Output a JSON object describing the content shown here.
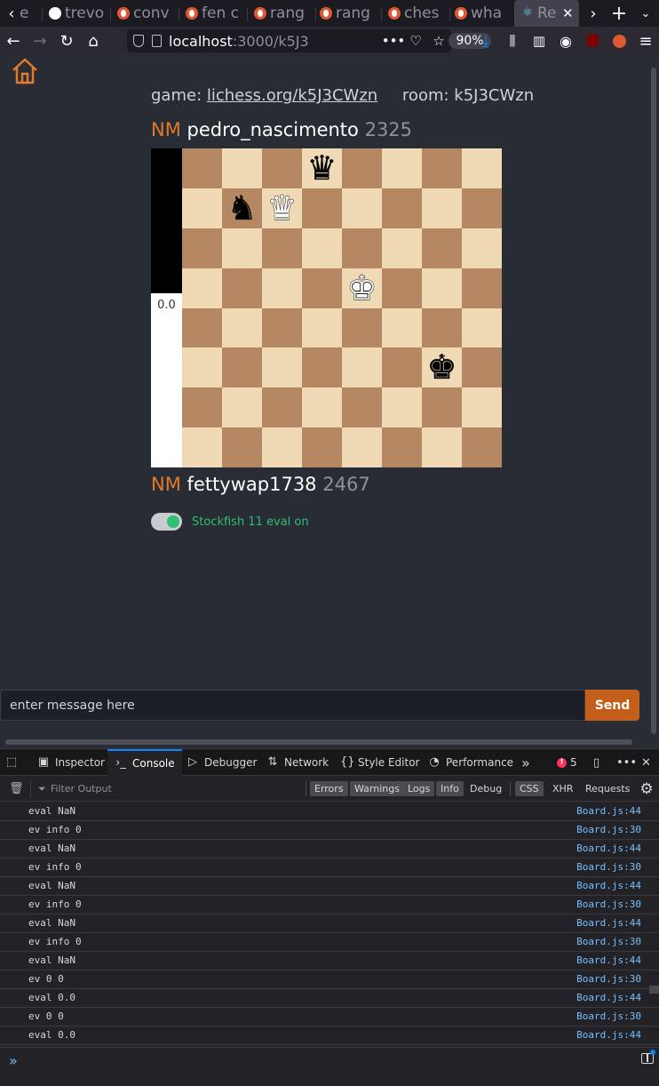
{
  "browser": {
    "tabs": [
      {
        "title": "e",
        "icon": "duckduckgo-icon"
      },
      {
        "title": "trevo",
        "icon": "github-icon"
      },
      {
        "title": "conv",
        "icon": "duckduckgo-icon"
      },
      {
        "title": "fen c",
        "icon": "duckduckgo-icon"
      },
      {
        "title": "rang",
        "icon": "duckduckgo-icon"
      },
      {
        "title": "rang",
        "icon": "duckduckgo-icon"
      },
      {
        "title": "ches",
        "icon": "duckduckgo-icon"
      },
      {
        "title": "wha",
        "icon": "duckduckgo-icon"
      },
      {
        "title": "Re",
        "icon": "react-icon",
        "active": true
      }
    ],
    "url_host": "localhost",
    "url_rest": ":3000/k5J3",
    "zoom": "90%"
  },
  "app": {
    "game_label": "game:",
    "game_link": "lichess.org/k5J3CWzn",
    "room_label": "room:",
    "room_id": "k5J3CWzn",
    "top_player": {
      "title": "NM",
      "name": "pedro_nascimento",
      "rating": "2325"
    },
    "bottom_player": {
      "title": "NM",
      "name": "fettywap1738",
      "rating": "2467"
    },
    "eval_value": "0.0",
    "eval_black_fraction": 0.455,
    "board": {
      "orientation": "black-bottom",
      "pieces": [
        {
          "square": "b6",
          "piece": "black-king"
        },
        {
          "square": "d4",
          "piece": "white-king"
        },
        {
          "square": "g2",
          "piece": "black-knight"
        },
        {
          "square": "f2",
          "piece": "white-queen"
        },
        {
          "square": "e1",
          "piece": "black-queen"
        }
      ]
    },
    "engine_toggle": {
      "on": true,
      "label": "Stockfish 11 eval on"
    },
    "chat": {
      "placeholder": "enter message here",
      "send_label": "Send"
    }
  },
  "devtools": {
    "tabs": [
      "Inspector",
      "Console",
      "Debugger",
      "Network",
      "Style Editor",
      "Performance"
    ],
    "active_tab": "Console",
    "error_count": "5",
    "filter_placeholder": "Filter Output",
    "filters": [
      "Errors",
      "Warnings",
      "Logs",
      "Info",
      "Debug"
    ],
    "extra_filters": [
      "CSS",
      "XHR",
      "Requests"
    ],
    "logs": [
      {
        "msg": "eval NaN",
        "src": "Board.js:44"
      },
      {
        "msg": "ev info 0",
        "src": "Board.js:30"
      },
      {
        "msg": "eval NaN",
        "src": "Board.js:44"
      },
      {
        "msg": "ev info 0",
        "src": "Board.js:30"
      },
      {
        "msg": "eval NaN",
        "src": "Board.js:44"
      },
      {
        "msg": "ev info 0",
        "src": "Board.js:30"
      },
      {
        "msg": "eval NaN",
        "src": "Board.js:44"
      },
      {
        "msg": "ev info 0",
        "src": "Board.js:30"
      },
      {
        "msg": "eval NaN",
        "src": "Board.js:44"
      },
      {
        "msg": "ev 0 0",
        "src": "Board.js:30"
      },
      {
        "msg": "eval 0.0",
        "src": "Board.js:44"
      },
      {
        "msg": "ev 0 0",
        "src": "Board.js:30"
      },
      {
        "msg": "eval 0.0",
        "src": "Board.js:44"
      }
    ]
  },
  "colors": {
    "accent_orange": "#e07b2c",
    "send_button": "#c35f1a",
    "toggle_green": "#2fbf71",
    "board_light": "#f0d9b5",
    "board_dark": "#b58863",
    "page_bg": "#282c34"
  }
}
